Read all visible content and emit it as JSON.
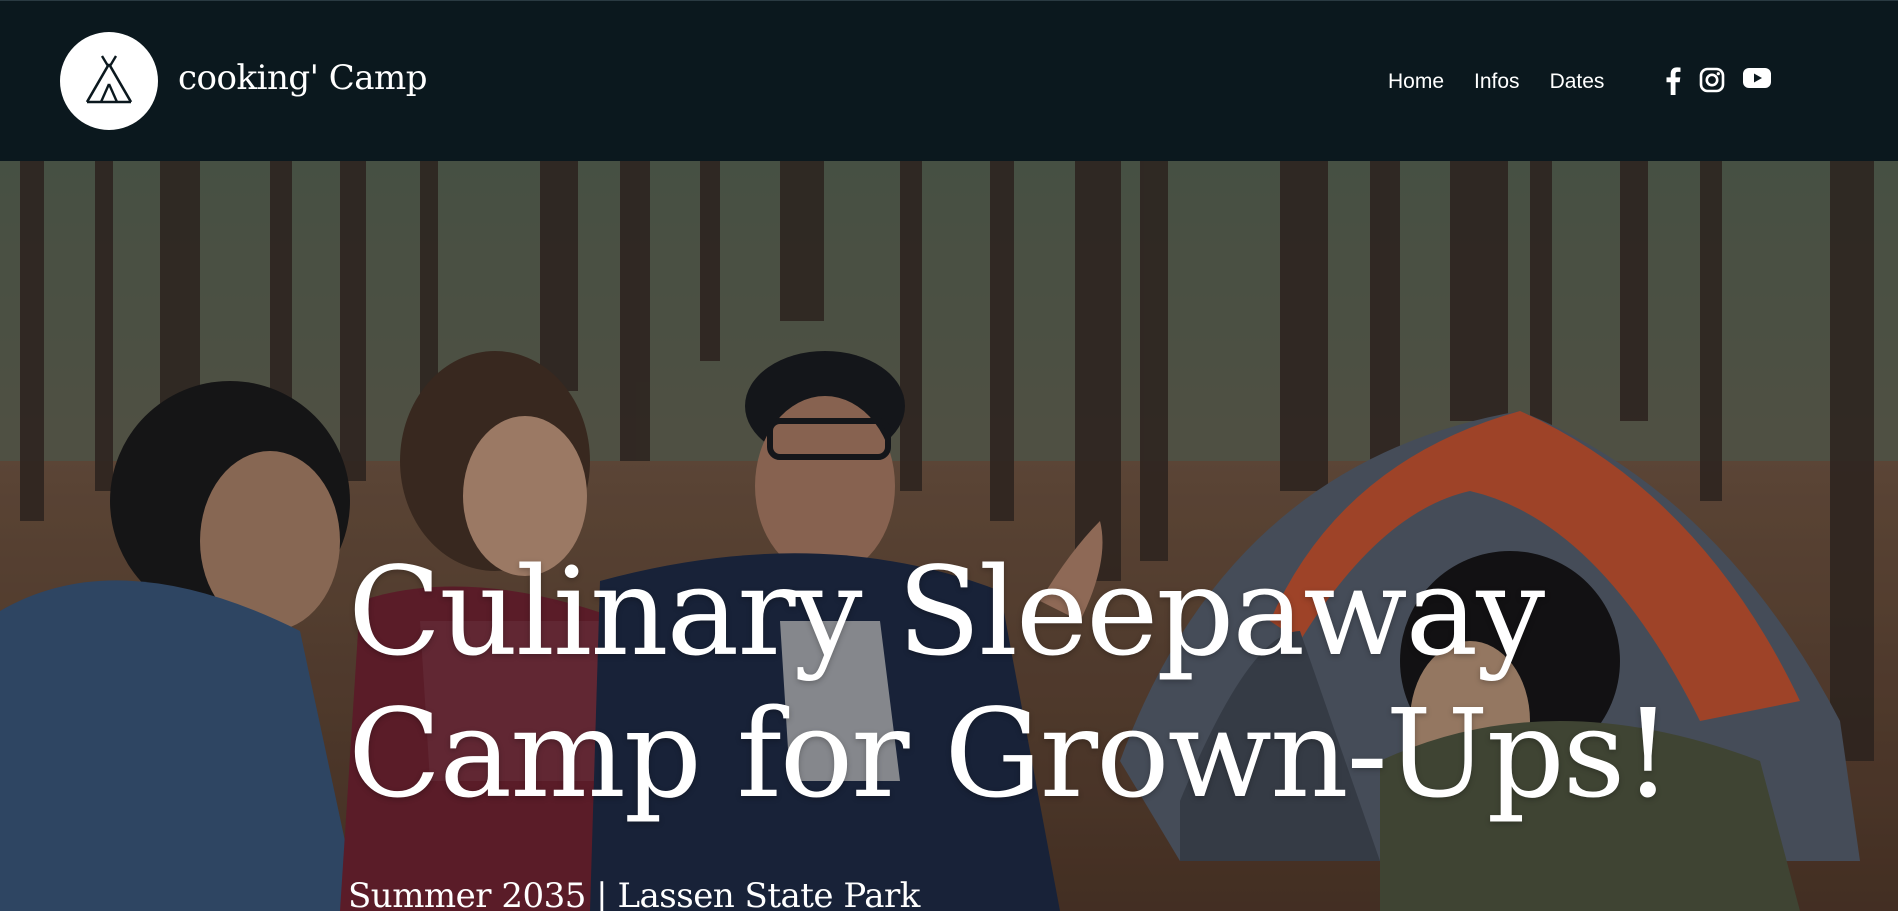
{
  "brand": {
    "name": "cooking' Camp",
    "logo_icon": "tent-icon"
  },
  "nav": {
    "items": [
      {
        "label": "Home"
      },
      {
        "label": "Infos"
      },
      {
        "label": "Dates"
      }
    ]
  },
  "social": {
    "items": [
      {
        "icon": "facebook-icon"
      },
      {
        "icon": "instagram-icon"
      },
      {
        "icon": "youtube-icon"
      }
    ]
  },
  "hero": {
    "title_line1": "Culinary Sleepaway",
    "title_line2": "Camp for Grown-Ups!",
    "subtitle": "Summer 2035 | Lassen State Park",
    "image": "photo of friends laughing around a campsite with an orange tent in a pine forest"
  },
  "colors": {
    "header_bg": "#0b181e",
    "text": "#ffffff",
    "tent_orange": "#d9582f"
  }
}
